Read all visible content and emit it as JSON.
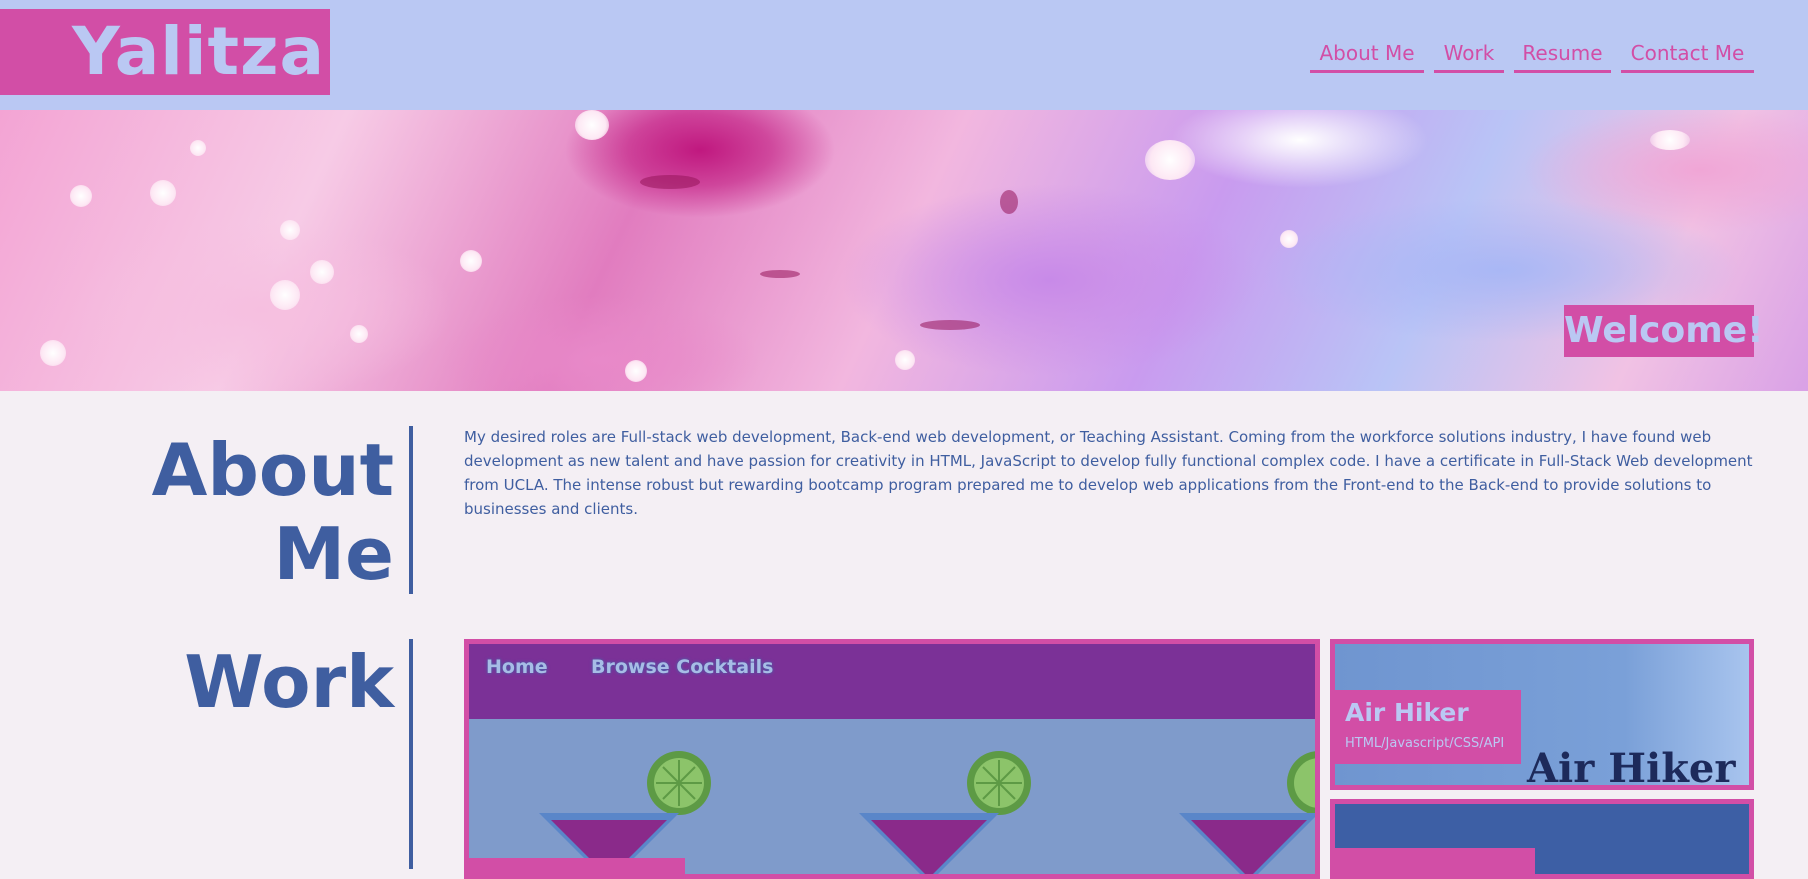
{
  "header": {
    "logo_text": "Yalitza",
    "nav": [
      "About Me",
      "Work",
      "Resume",
      "Contact Me"
    ]
  },
  "hero": {
    "welcome": "Welcome!"
  },
  "about": {
    "title_line1": "About",
    "title_line2": "Me",
    "text": "My desired roles are Full-stack web development, Back-end web development, or Teaching Assistant. Coming from the workforce solutions industry, I have found web development as new talent and have passion for creativity in HTML, JavaScript to develop fully functional complex code. I have a certificate in Full-Stack Web development from UCLA. The intense robust but rewarding bootcamp program prepared me to develop web applications from the Front-end to the Back-end to provide solutions to businesses and clients."
  },
  "work": {
    "title": "Work",
    "main_card": {
      "nav": [
        "Home",
        "Browse Cocktails"
      ]
    },
    "side_cards": [
      {
        "title": "Air Hiker",
        "subtitle": "HTML/Javascript/CSS/API",
        "image_text": "Air Hiker"
      }
    ]
  },
  "colors": {
    "header_bg": "#bac8f3",
    "accent_pink": "#d24ea6",
    "text_blue": "#3f5ea0",
    "page_bg": "#f4eff4",
    "cocktail_nav": "#7b3197"
  },
  "icons": [
    "cocktail-glass-icon",
    "lime-slice-icon"
  ]
}
